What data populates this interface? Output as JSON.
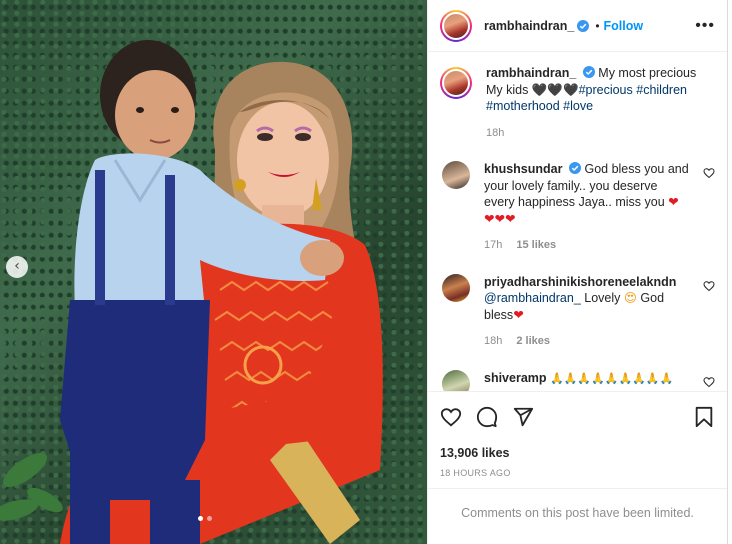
{
  "post": {
    "username": "rambhaindran_",
    "follow_label": "Follow",
    "separator": "•",
    "more_label": "•••",
    "caption_text": "My most precious My kids",
    "caption_hearts": "🖤🖤🖤",
    "caption_tags": [
      "#precious",
      "#children",
      "#motherhood",
      "#love"
    ],
    "caption_time": "18h",
    "likes": "13,906 likes",
    "time_ago": "18 HOURS AGO",
    "comments_limited": "Comments on this post have been limited."
  },
  "comments": [
    {
      "username": "khushsundar",
      "text": "God bless you and your lovely family.. you deserve every happiness Jaya.. miss you",
      "emoji": "❤",
      "emoji_line": "❤❤❤",
      "time": "17h",
      "likes": "15 likes"
    },
    {
      "username": "priyadharshinikishoreneelakndn",
      "mention": "@rambhaindran_",
      "text": "Lovely",
      "emoji": "😍",
      "text_after": "God bless",
      "emoji_end": "❤",
      "time": "18h",
      "likes": "2 likes"
    },
    {
      "username": "shiveramp",
      "emoji_line": "🙏🙏🙏🙏🙏🙏🙏🙏🙏"
    }
  ],
  "carousel": {
    "prev_label": "‹",
    "dots": 2,
    "active_dot": 1
  },
  "colors": {
    "link": "#0095f6",
    "tag": "#00376b",
    "heart": "#e31b23",
    "muted": "#8e8e8e"
  }
}
